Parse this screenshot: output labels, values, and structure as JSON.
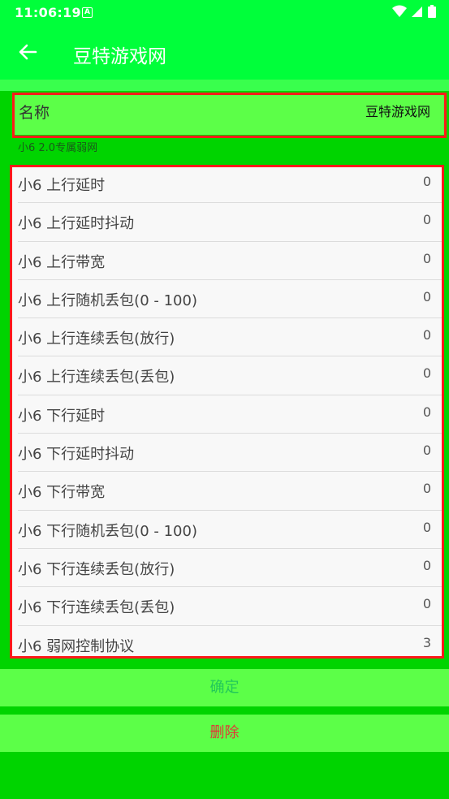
{
  "status": {
    "time": "11:06:19",
    "badge": "A"
  },
  "appbar": {
    "title": "豆特游戏网"
  },
  "name_row": {
    "label": "名称",
    "value": "豆特游戏网"
  },
  "subtitle": "小6 2.0专属弱网",
  "items": [
    {
      "label": "小6  上行延时",
      "value": "0"
    },
    {
      "label": "小6  上行延时抖动",
      "value": "0"
    },
    {
      "label": "小6  上行带宽",
      "value": "0"
    },
    {
      "label": "小6  上行随机丢包(0 - 100)",
      "value": "0"
    },
    {
      "label": "小6  上行连续丢包(放行)",
      "value": "0"
    },
    {
      "label": "小6  上行连续丢包(丢包)",
      "value": "0"
    },
    {
      "label": "小6  下行延时",
      "value": "0"
    },
    {
      "label": "小6  下行延时抖动",
      "value": "0"
    },
    {
      "label": "小6  下行带宽",
      "value": "0"
    },
    {
      "label": "小6  下行随机丢包(0 - 100)",
      "value": "0"
    },
    {
      "label": "小6  下行连续丢包(放行)",
      "value": "0"
    },
    {
      "label": "小6  下行连续丢包(丢包)",
      "value": "0"
    },
    {
      "label": "小6  弱网控制协议",
      "value": "3"
    }
  ],
  "buttons": {
    "confirm": "确定",
    "delete": "删除"
  }
}
